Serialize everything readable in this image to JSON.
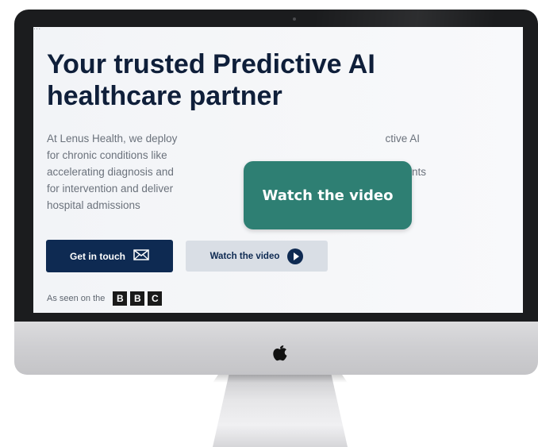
{
  "hero": {
    "top_strip_text": "...",
    "headline": "Your trusted Predictive AI healthcare partner",
    "body_line_1": "At Lenus Health, we deploy",
    "body_line_1b": "ctive AI",
    "body_line_2": "for chronic conditions like",
    "body_line_3": "accelerating diagnosis and",
    "body_line_3b": "atients",
    "body_line_4": "for intervention and deliver",
    "body_line_5": "hospital admissions"
  },
  "buttons": {
    "get_in_touch": "Get in touch",
    "watch_video": "Watch the video"
  },
  "press": {
    "label": "As seen on the",
    "letters": [
      "B",
      "B",
      "C"
    ]
  },
  "overlay": {
    "label": "Watch the video"
  },
  "icons": {
    "mail": "mail-icon",
    "play": "play-icon",
    "apple": "apple-logo-icon"
  },
  "colors": {
    "navy": "#0e2a52",
    "teal_overlay": "#2e7f73",
    "secondary_button": "#d9dee5",
    "bezel": "#1b1c1e"
  }
}
